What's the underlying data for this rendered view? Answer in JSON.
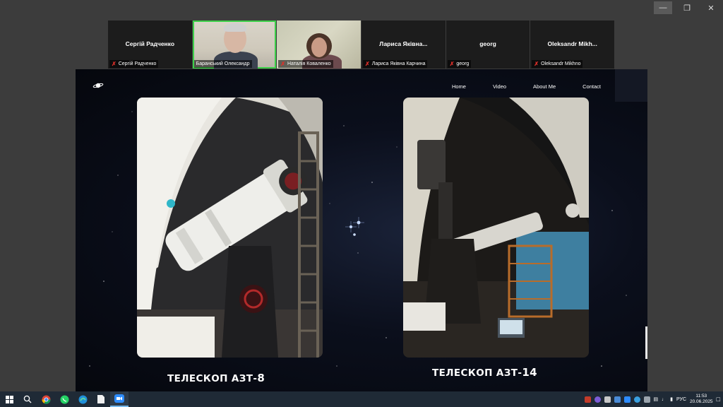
{
  "participants": [
    {
      "center_name": "Сергій Радченко",
      "caption": "Сергій Радченко",
      "has_video": false
    },
    {
      "center_name": "",
      "caption": "Баранський Олександр",
      "has_video": true,
      "active": true
    },
    {
      "center_name": "",
      "caption": "Наталія Коваленко",
      "has_video": true
    },
    {
      "center_name": "Лариса Яківна...",
      "caption": "Лариса Яківна Карчина",
      "has_video": false
    },
    {
      "center_name": "georg",
      "caption": "georg",
      "has_video": false
    },
    {
      "center_name": "Oleksandr Mikh...",
      "caption": "Oleksandr Mikhno",
      "has_video": false
    }
  ],
  "site": {
    "nav": [
      "Home",
      "Video",
      "About Me",
      "Contact"
    ],
    "captions": [
      {
        "prefix": "ТЕЛЕСКОП АЗТ-",
        "number": "8"
      },
      {
        "prefix": "ТЕЛЕСКОП АЗТ-",
        "number": "14"
      }
    ]
  },
  "taskbar": {
    "language": "РУС",
    "time": "11:53",
    "date": "20.06.2025"
  },
  "colors": {
    "active_speaker": "#3ed14a",
    "muted": "#e0302a",
    "taskbar": "#1f2a36"
  }
}
